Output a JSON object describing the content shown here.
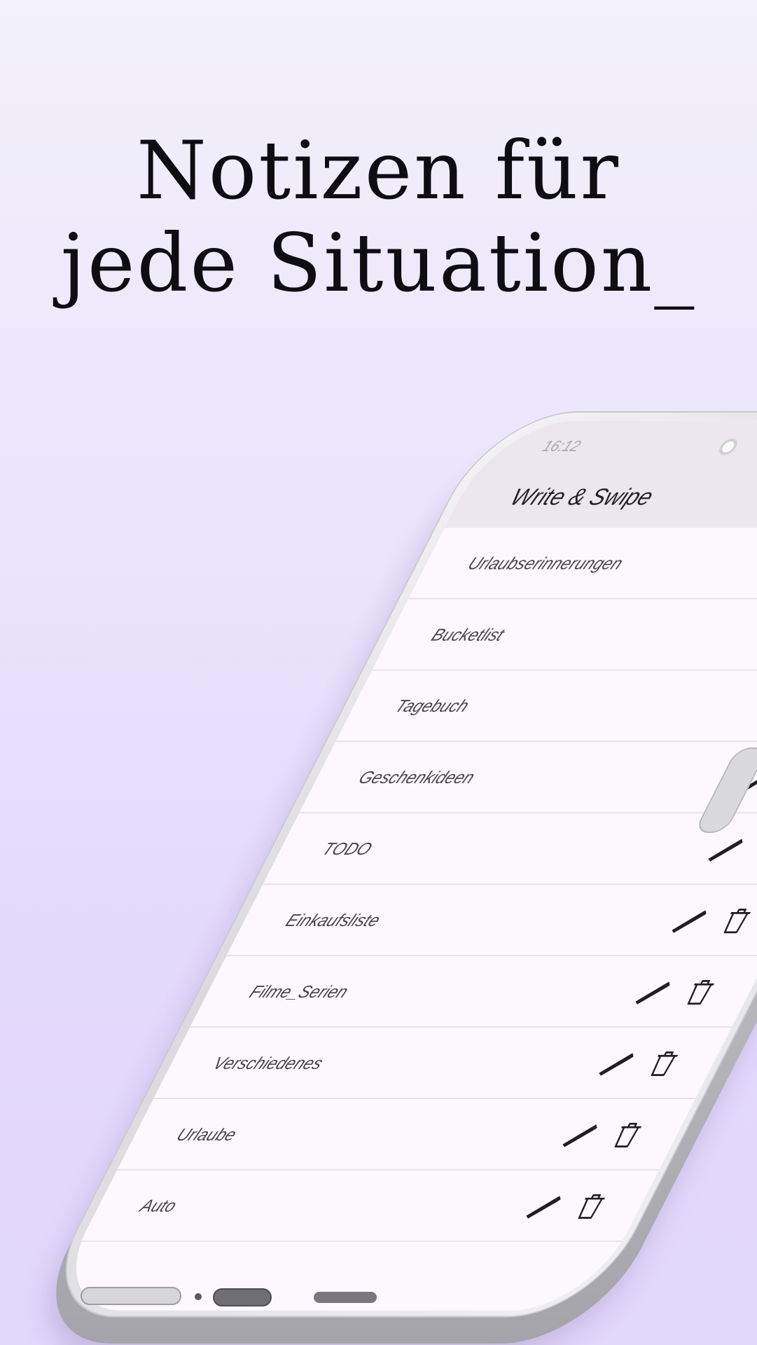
{
  "headline": {
    "line1": "Notizen für",
    "line2": "jede Situation_"
  },
  "status": {
    "time": "16:12"
  },
  "app": {
    "title": "Write & Swipe",
    "actions": [
      {
        "icon": "sync-icon"
      },
      {
        "icon": "add-note-icon"
      }
    ]
  },
  "notes": [
    {
      "label": "Urlaubserinnerungen"
    },
    {
      "label": "Bucketlist"
    },
    {
      "label": "Tagebuch"
    },
    {
      "label": "Geschenkideen"
    },
    {
      "label": "TODO"
    },
    {
      "label": "Einkaufsliste"
    },
    {
      "label": "Filme_Serien"
    },
    {
      "label": "Verschiedenes"
    },
    {
      "label": "Urlaube"
    },
    {
      "label": "Auto"
    }
  ],
  "colors": {
    "background_top": "#f3f1fa",
    "background_bottom": "#e2d7fc",
    "appbar": "#ece7ee",
    "list_background": "#fdf8fd",
    "headline_text": "#0d0d12"
  }
}
